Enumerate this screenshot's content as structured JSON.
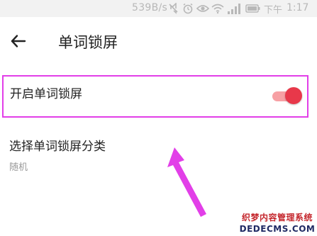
{
  "status_bar": {
    "net_speed": "539B/s",
    "carrier": "下午",
    "time": "1:17",
    "icons": [
      "mute-icon",
      "alarm-icon",
      "eye-icon",
      "wifi-icon",
      "signal-icon",
      "battery-icon"
    ]
  },
  "toolbar": {
    "back_icon": "arrow-left-icon",
    "title": "单词锁屏"
  },
  "settings": {
    "lock_screen": {
      "label": "开启单词锁屏",
      "enabled": true
    },
    "category": {
      "label": "选择单词锁屏分类",
      "value": "随机"
    }
  },
  "annotation": {
    "color": "#e23fe8"
  },
  "watermark": {
    "top": "织梦内容管理系统",
    "bottom": "DEDECMS.COM"
  },
  "colors": {
    "toggle_thumb": "#e8384a",
    "toggle_track": "#f7a0a4"
  }
}
